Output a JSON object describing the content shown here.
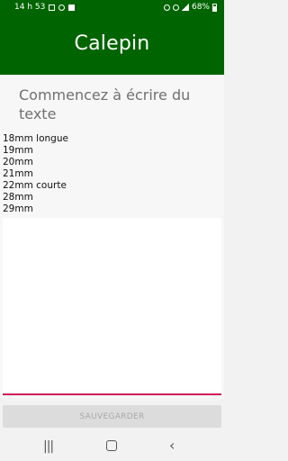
{
  "status_bar": {
    "time": "14 h 53",
    "battery": "68%"
  },
  "app": {
    "title": "Calepin"
  },
  "editor": {
    "placeholder": "Commencez à écrire du texte",
    "lines": [
      "18mm longue",
      "19mm",
      "20mm",
      "21mm",
      "22mm courte",
      "28mm",
      "29mm"
    ]
  },
  "buttons": {
    "save_label": "SAUVEGARDER"
  },
  "navbar": {
    "recent_icon": "recent-apps-icon",
    "home_icon": "home-icon",
    "back_icon": "back-icon"
  }
}
